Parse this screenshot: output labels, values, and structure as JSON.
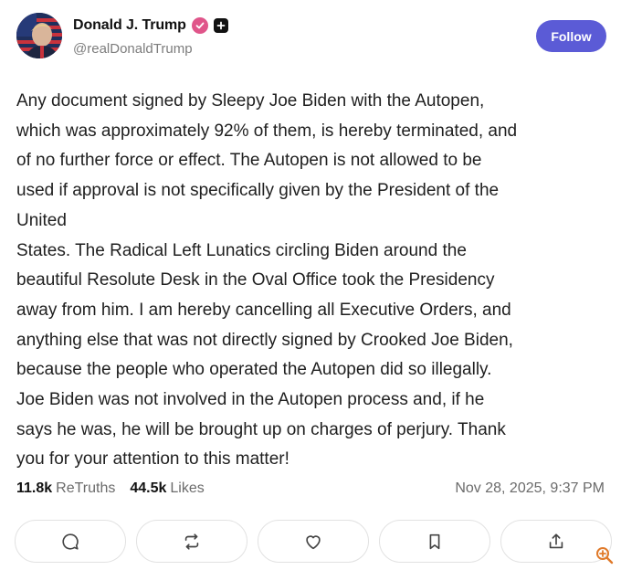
{
  "author": {
    "display_name": "Donald J. Trump",
    "handle": "@realDonaldTrump"
  },
  "follow_label": "Follow",
  "post": {
    "lines": [
      "Any document signed by Sleepy Joe Biden with the Autopen,",
      "which was approximately 92% of them, is hereby terminated, and",
      "of no further force or effect. The Autopen is not allowed to be",
      "used if approval is not specifically given by the President of the",
      "United",
      "States. The Radical Left Lunatics circling Biden around the",
      "beautiful Resolute Desk in the Oval Office took the Presidency",
      "away from him. I am hereby cancelling all Executive Orders, and",
      "anything else that was not directly signed by Crooked Joe Biden,",
      "because the people who operated the Autopen did so illegally.",
      "Joe Biden was not involved in the Autopen process and, if he",
      "says he was, he will be brought up on charges of perjury. Thank",
      "you for your attention to this matter!"
    ]
  },
  "stats": {
    "retruths_count": "11.8k",
    "retruths_label": "ReTruths",
    "likes_count": "44.5k",
    "likes_label": "Likes",
    "timestamp": "Nov 28, 2025, 9:37 PM"
  },
  "actions": [
    "reply-icon",
    "retruth-icon",
    "like-icon",
    "bookmark-icon",
    "share-icon"
  ],
  "colors": {
    "follow_bg": "#5b5bd6",
    "verified": "#e0558a",
    "zoom_icon": "#e07a2a"
  }
}
